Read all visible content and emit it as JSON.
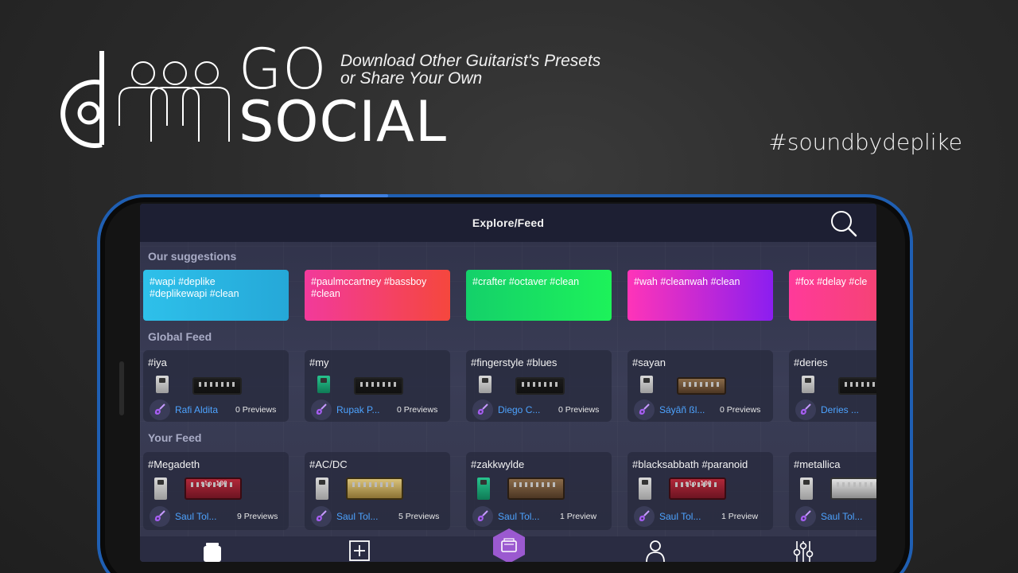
{
  "promo": {
    "go": "GO",
    "social": "SOCIAL",
    "tagline_line1": "Download Other Guitarist's Presets",
    "tagline_line2": "or Share Your Own",
    "hashtag": "#soundbydeplike"
  },
  "app": {
    "title": "Explore/Feed",
    "sections": {
      "suggestions": "Our suggestions",
      "global": "Global Feed",
      "yours": "Your Feed"
    },
    "suggestions": [
      {
        "text": "#wapi #deplike\n#deplikewapi #clean",
        "gradient": [
          "#2ec0ea",
          "#25a8d8"
        ]
      },
      {
        "text": "#paulmccartney #bassboy\n#clean",
        "gradient": [
          "#f23a9b",
          "#f5473d"
        ]
      },
      {
        "text": "#crafter #octaver #clean",
        "gradient": [
          "#14d06a",
          "#1df25a"
        ]
      },
      {
        "text": "#wah #cleanwah #clean",
        "gradient": [
          "#ff34b8",
          "#8b1ef0"
        ]
      },
      {
        "text": "#fox #delay #cle",
        "gradient": [
          "#ff3a9a",
          "#f0485e"
        ]
      }
    ],
    "global_feed": [
      {
        "tags": "#iya",
        "user": "Rafi Aldita",
        "previews": "0 Previews",
        "pedal": "silver",
        "amp": "dark"
      },
      {
        "tags": "#my",
        "user": "Rupak P...",
        "previews": "0 Previews",
        "pedal": "green",
        "amp": "dark"
      },
      {
        "tags": "#fingerstyle #blues",
        "user": "Diego C...",
        "previews": "0 Previews",
        "pedal": "silver",
        "amp": "dark"
      },
      {
        "tags": "#sayan",
        "user": "Sáyâñ ßl...",
        "previews": "0 Previews",
        "pedal": "silver",
        "amp": "brown"
      },
      {
        "tags": "#deries",
        "user": "Deries ...",
        "previews": "",
        "pedal": "silver",
        "amp": "dark"
      }
    ],
    "your_feed": [
      {
        "tags": "#Megadeth",
        "user": "Saul Tol...",
        "previews": "9 Previews",
        "pedal": "silver",
        "amp": "red"
      },
      {
        "tags": "#AC/DC",
        "user": "Saul Tol...",
        "previews": "5 Previews",
        "pedal": "silver",
        "amp": "gold"
      },
      {
        "tags": "#zakkwylde",
        "user": "Saul Tol...",
        "previews": "1 Preview",
        "pedal": "green",
        "amp": "brown"
      },
      {
        "tags": "#blacksabbath #paranoid",
        "user": "Saul Tol...",
        "previews": "1 Preview",
        "pedal": "silver",
        "amp": "red"
      },
      {
        "tags": "#metallica",
        "user": "Saul Tol...",
        "previews": "",
        "pedal": "silver",
        "amp": "silver"
      }
    ],
    "nav": [
      "presets-icon",
      "add-icon",
      "amp-icon",
      "profile-icon",
      "mixer-icon"
    ],
    "accent": "#4da3ff",
    "center_nav_color": "#9b59d0"
  }
}
